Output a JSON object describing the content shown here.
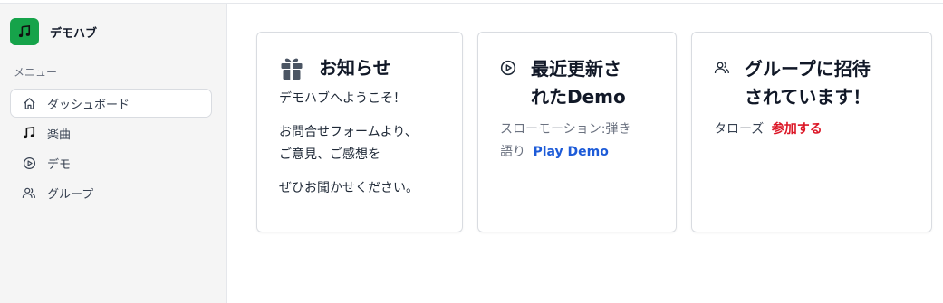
{
  "app": {
    "name": "デモハブ",
    "logo_icon": "music-note-icon",
    "brand_color": "#16a34a"
  },
  "sidebar": {
    "menu_label": "メニュー",
    "items": [
      {
        "label": "ダッシュボード",
        "icon": "home-icon",
        "active": true
      },
      {
        "label": "楽曲",
        "icon": "music-note-icon",
        "active": false
      },
      {
        "label": "デモ",
        "icon": "play-circle-icon",
        "active": false
      },
      {
        "label": "グループ",
        "icon": "users-icon",
        "active": false
      }
    ]
  },
  "cards": {
    "news": {
      "icon": "gift-icon",
      "title": "お知らせ",
      "welcome": "デモハブへようこそ！",
      "line1": "お問合せフォームより、",
      "line2": "ご意見、ご感想を",
      "line3": "ぜひお聞かせください。"
    },
    "demo": {
      "icon": "play-circle-icon",
      "title_line1": "最近更新さ",
      "title_line2": "れたDemo",
      "desc_line1": "スローモーション:弾き",
      "desc_line2": "語り",
      "link": "Play Demo",
      "link_color": "#1d5bd8"
    },
    "invite": {
      "icon": "users-icon",
      "title_line1": "グループに招待",
      "title_line2": "されています！",
      "group": "タローズ",
      "join": "参加する",
      "join_color": "#dc1626"
    }
  }
}
